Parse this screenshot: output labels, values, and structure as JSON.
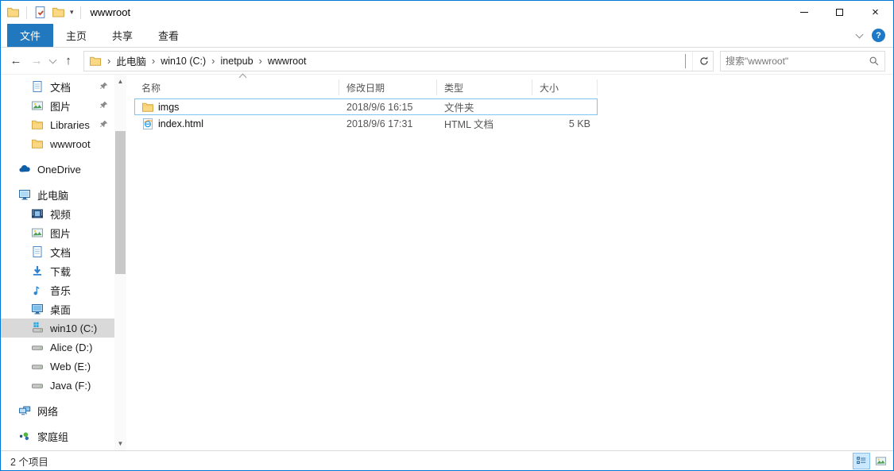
{
  "window": {
    "title": "wwwroot"
  },
  "quick_access": {
    "icons": [
      "explorer-icon",
      "properties-icon",
      "new-folder-icon",
      "qat-dropdown-icon"
    ]
  },
  "ribbon": {
    "tabs": [
      "文件",
      "主页",
      "共享",
      "查看"
    ],
    "active_tab": "文件"
  },
  "address_bar": {
    "crumbs": [
      "此电脑",
      "win10 (C:)",
      "inetpub",
      "wwwroot"
    ],
    "separator": "›",
    "search_placeholder": "搜索\"wwwroot\""
  },
  "sidebar": {
    "items": [
      {
        "label": "文档",
        "icon": "document",
        "indent": 1,
        "pinned": true
      },
      {
        "label": "图片",
        "icon": "picture",
        "indent": 1,
        "pinned": true
      },
      {
        "label": "Libraries",
        "icon": "folder",
        "indent": 1,
        "pinned": true
      },
      {
        "label": "wwwroot",
        "icon": "folder",
        "indent": 1,
        "pinned": false
      },
      {
        "label": "OneDrive",
        "icon": "onedrive",
        "indent": 0,
        "gap": true
      },
      {
        "label": "此电脑",
        "icon": "computer",
        "indent": 0,
        "gap": true
      },
      {
        "label": "视频",
        "icon": "video",
        "indent": 1
      },
      {
        "label": "图片",
        "icon": "picture",
        "indent": 1
      },
      {
        "label": "文档",
        "icon": "document",
        "indent": 1
      },
      {
        "label": "下载",
        "icon": "download",
        "indent": 1
      },
      {
        "label": "音乐",
        "icon": "music",
        "indent": 1
      },
      {
        "label": "桌面",
        "icon": "desktop",
        "indent": 1
      },
      {
        "label": "win10 (C:)",
        "icon": "windows-drive",
        "indent": 1,
        "selected": true
      },
      {
        "label": "Alice (D:)",
        "icon": "drive",
        "indent": 1
      },
      {
        "label": "Web (E:)",
        "icon": "drive",
        "indent": 1
      },
      {
        "label": "Java (F:)",
        "icon": "drive",
        "indent": 1
      },
      {
        "label": "网络",
        "icon": "network",
        "indent": 0,
        "gap": true
      },
      {
        "label": "家庭组",
        "icon": "homegroup",
        "indent": 0,
        "gap": true
      }
    ]
  },
  "file_list": {
    "columns": [
      "名称",
      "修改日期",
      "类型",
      "大小"
    ],
    "sort_column": "名称",
    "sort_direction": "ascending",
    "rows": [
      {
        "name": "imgs",
        "date": "2018/9/6 16:15",
        "type": "文件夹",
        "size": "",
        "icon": "folder",
        "selected": true
      },
      {
        "name": "index.html",
        "date": "2018/9/6 17:31",
        "type": "HTML 文档",
        "size": "5 KB",
        "icon": "ie-page",
        "selected": false
      }
    ]
  },
  "status_bar": {
    "item_count": "2 个项目"
  },
  "colors": {
    "accent": "#0078d7",
    "file_tab_bg": "#2178be",
    "selection_border": "#7fc3f1",
    "sidebar_selected_bg": "#d9d9d9",
    "view_button_active_bg": "#cce8ff"
  }
}
